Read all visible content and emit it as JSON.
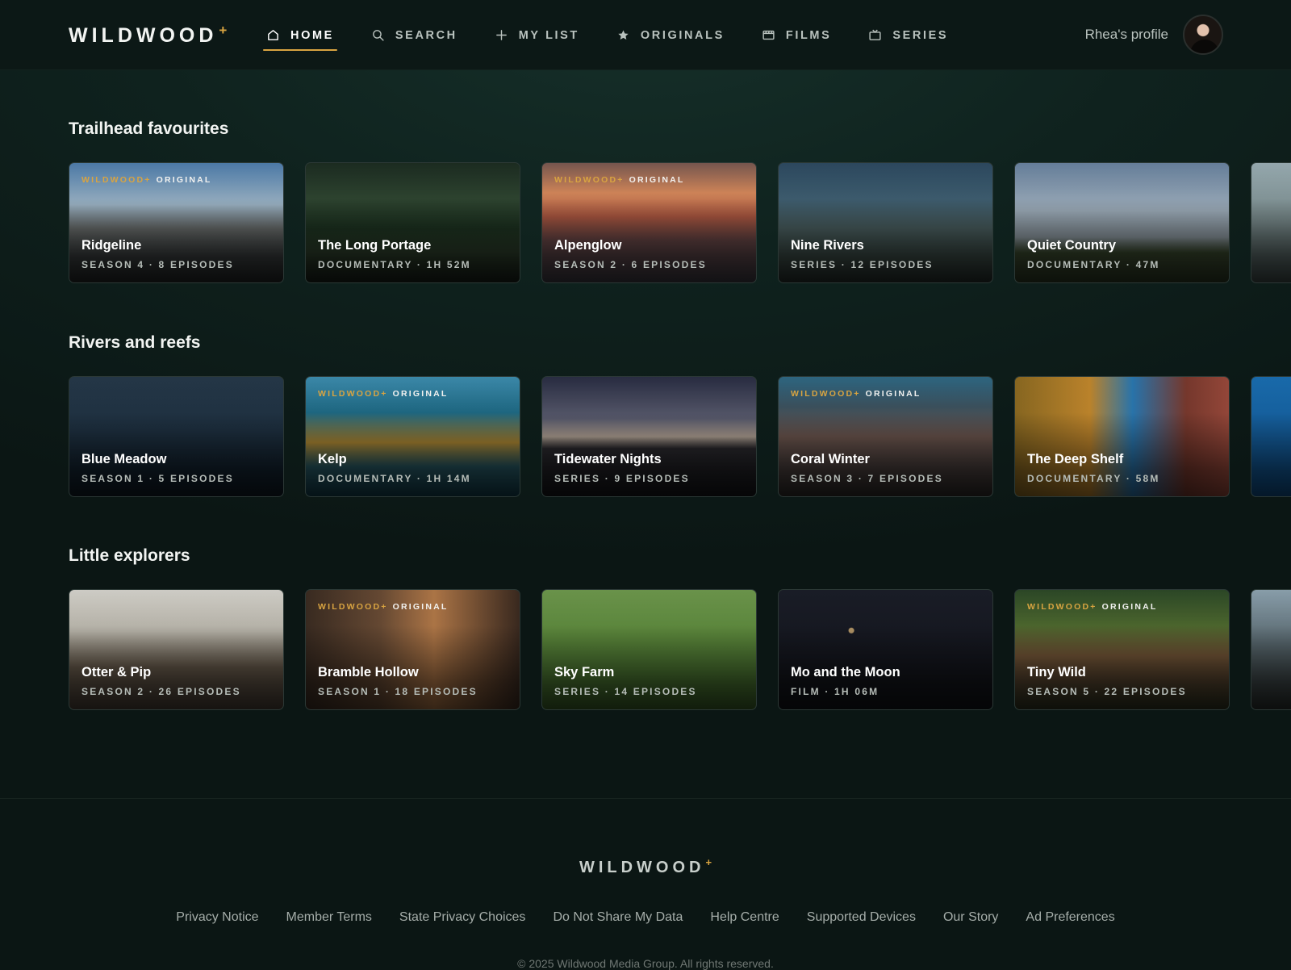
{
  "brand": {
    "name": "WILDWOOD",
    "mark": "+"
  },
  "colors": {
    "accent": "#d9a441",
    "background": "#0b1614"
  },
  "nav": [
    {
      "label": "HOME",
      "icon": "home-icon",
      "active": true
    },
    {
      "label": "SEARCH",
      "icon": "search-icon",
      "active": false
    },
    {
      "label": "MY LIST",
      "icon": "plus-icon",
      "active": false
    },
    {
      "label": "ORIGINALS",
      "icon": "star-icon",
      "active": false
    },
    {
      "label": "FILMS",
      "icon": "film-icon",
      "active": false
    },
    {
      "label": "SERIES",
      "icon": "tv-icon",
      "active": false
    }
  ],
  "profile": {
    "label": "Rhea's profile"
  },
  "badge": {
    "brand": "WILDWOOD+",
    "tag": "ORIGINAL"
  },
  "rows": [
    {
      "title": "Trailhead favourites",
      "cards": [
        {
          "title": "Ridgeline",
          "meta": "SEASON 4 · 8 EPISODES",
          "original": true,
          "art": "art-ridge"
        },
        {
          "title": "The Long Portage",
          "meta": "DOCUMENTARY · 1H 52M",
          "original": false,
          "art": "art-portage"
        },
        {
          "title": "Alpenglow",
          "meta": "SEASON 2 · 6 EPISODES",
          "original": true,
          "art": "art-alpen"
        },
        {
          "title": "Nine Rivers",
          "meta": "SERIES · 12 EPISODES",
          "original": false,
          "art": "art-nine"
        },
        {
          "title": "Quiet Country",
          "meta": "DOCUMENTARY · 47M",
          "original": false,
          "art": "art-quiet"
        },
        {
          "title": "",
          "meta": "",
          "original": false,
          "art": "art-edge1"
        }
      ]
    },
    {
      "title": "Rivers and reefs",
      "cards": [
        {
          "title": "Blue Meadow",
          "meta": "SEASON 1 · 5 EPISODES",
          "original": false,
          "art": "art-blue"
        },
        {
          "title": "Kelp",
          "meta": "DOCUMENTARY · 1H 14M",
          "original": true,
          "art": "art-kelp"
        },
        {
          "title": "Tidewater Nights",
          "meta": "SERIES · 9 EPISODES",
          "original": false,
          "art": "art-tide"
        },
        {
          "title": "Coral Winter",
          "meta": "SEASON 3 · 7 EPISODES",
          "original": true,
          "art": "art-coral"
        },
        {
          "title": "The Deep Shelf",
          "meta": "DOCUMENTARY · 58M",
          "original": false,
          "art": "art-deep"
        },
        {
          "title": "",
          "meta": "",
          "original": false,
          "art": "art-edge2"
        }
      ]
    },
    {
      "title": "Little explorers",
      "cards": [
        {
          "title": "Otter & Pip",
          "meta": "SEASON 2 · 26 EPISODES",
          "original": false,
          "art": "art-otter"
        },
        {
          "title": "Bramble Hollow",
          "meta": "SEASON 1 · 18 EPISODES",
          "original": true,
          "art": "art-bramble"
        },
        {
          "title": "Sky Farm",
          "meta": "SERIES · 14 EPISODES",
          "original": false,
          "art": "art-sky"
        },
        {
          "title": "Mo and the Moon",
          "meta": "FILM · 1H 06M",
          "original": false,
          "art": "art-moon"
        },
        {
          "title": "Tiny Wild",
          "meta": "SEASON 5 · 22 EPISODES",
          "original": true,
          "art": "art-tiny"
        },
        {
          "title": "",
          "meta": "",
          "original": false,
          "art": "art-edge3"
        }
      ]
    }
  ],
  "footer": {
    "links": [
      "Privacy Notice",
      "Member Terms",
      "State Privacy Choices",
      "Do Not Share My Data",
      "Help Centre",
      "Supported Devices",
      "Our Story",
      "Ad Preferences"
    ],
    "copyright": "© 2025 Wildwood Media Group. All rights reserved."
  }
}
